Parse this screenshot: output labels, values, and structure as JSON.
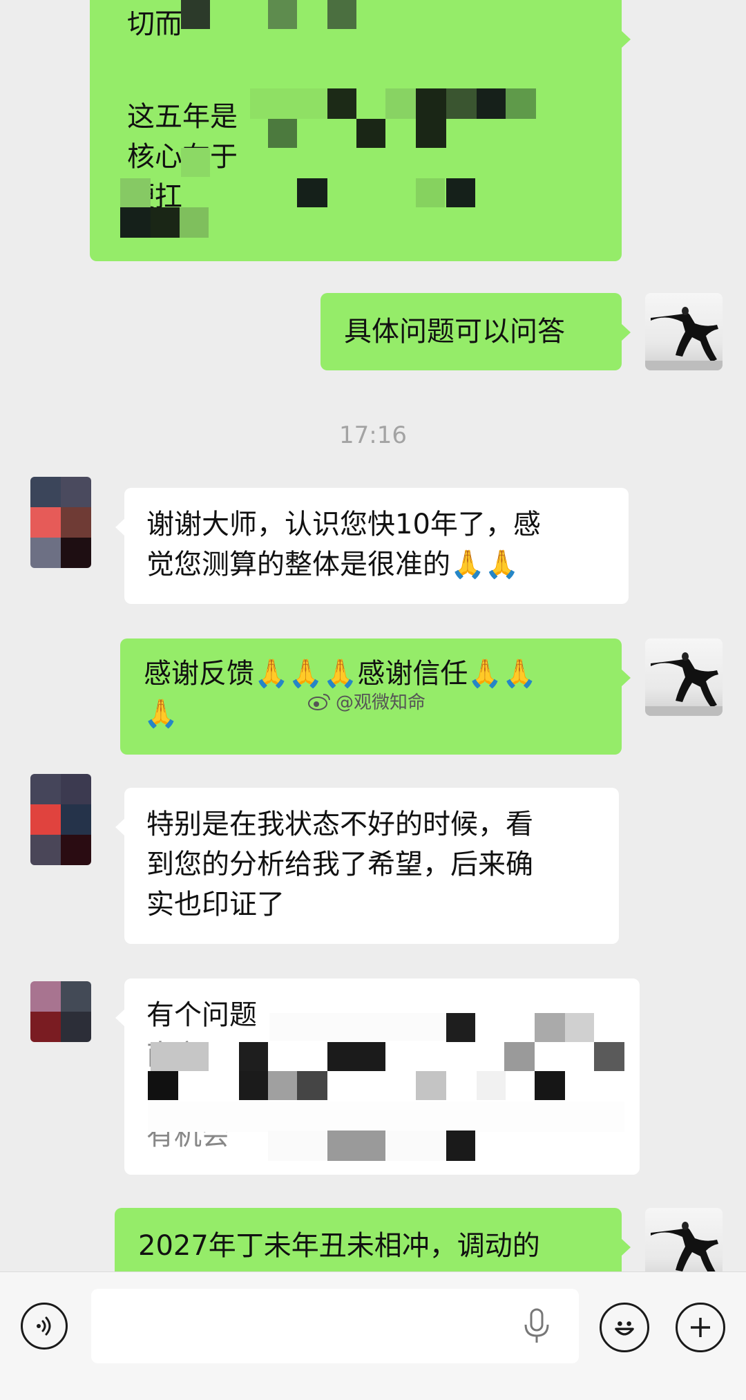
{
  "messages": [
    {
      "sender": "self",
      "lines": [
        "切而",
        "",
        "这五年是",
        "核心在于",
        "硬扛"
      ]
    },
    {
      "sender": "self",
      "text": "具体问题可以问答"
    },
    {
      "sender": "timestamp",
      "text": "17:16"
    },
    {
      "sender": "other",
      "lines": [
        "谢谢大师，认识您快10年了，感",
        "觉您测算的整体是很准的"
      ],
      "emoji": "🙏🙏"
    },
    {
      "sender": "self",
      "line1_a": "感谢反馈",
      "line1_emoji_a": "🙏🙏🙏",
      "line1_b": "感谢信任",
      "line1_emoji_b": "🙏🙏",
      "line2_emoji": "🙏"
    },
    {
      "sender": "other",
      "lines": [
        "特别是在我状态不好的时候，看",
        "到您的分析给我了希望，后来确",
        "实也印证了"
      ]
    },
    {
      "sender": "other",
      "lines": [
        "有个问题",
        "南京",
        "",
        "有机会"
      ]
    },
    {
      "sender": "self",
      "text": "2027年丁未年丑未相冲，调动的"
    }
  ],
  "watermark": {
    "icon": "weibo-icon",
    "text": "@观微知命"
  },
  "input_bar": {
    "left_icon": "voice-icon",
    "input_value": "",
    "mic_icon": "microphone-icon",
    "emoji_icon": "smiley-icon",
    "plus_icon": "plus-icon"
  },
  "colors": {
    "self_bubble": "#95ec69",
    "other_bubble": "#ffffff",
    "background": "#ededed",
    "timestamp": "#a3a3a3"
  }
}
